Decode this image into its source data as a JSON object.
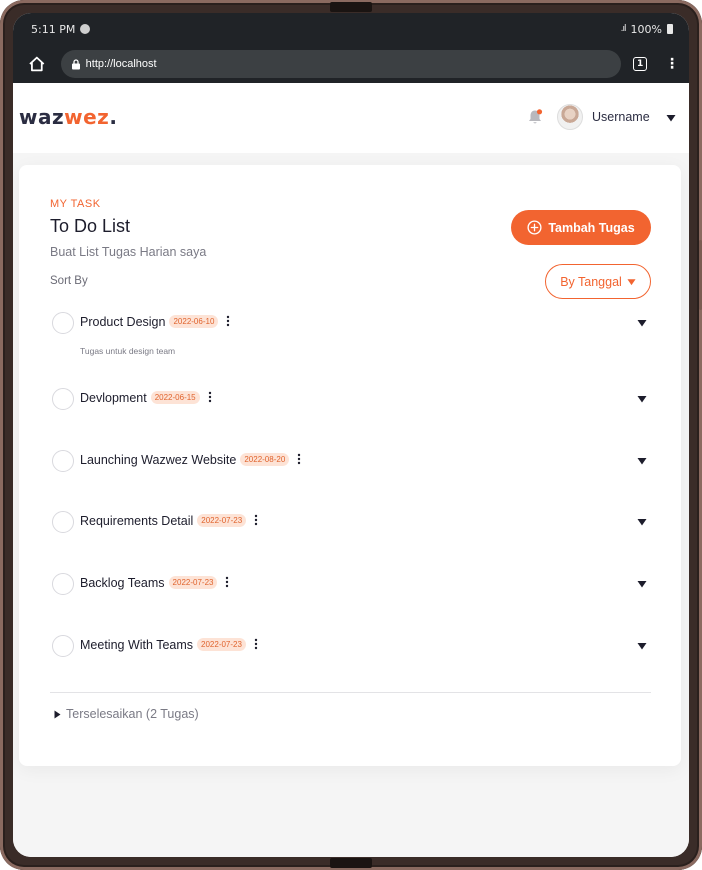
{
  "status_bar": {
    "time": "5:11 PM",
    "battery": "100%"
  },
  "browser": {
    "url": "http://localhost",
    "tab_count": "1"
  },
  "app": {
    "logo_part1": "waz",
    "logo_part2": "wez",
    "logo_dot": ".",
    "username": "Username",
    "accent_color": "#f26430"
  },
  "main": {
    "eyebrow": "MY TASK",
    "title": "To Do List",
    "subtitle": "Buat List Tugas Harian saya",
    "sort_label": "Sort By",
    "add_button": "Tambah Tugas",
    "sort_button": "By Tanggal",
    "tasks": [
      {
        "name": "Product Design",
        "date": "2022-06-10",
        "description": "Tugas untuk design team"
      },
      {
        "name": "Devlopment",
        "date": "2022-06-15"
      },
      {
        "name": "Launching Wazwez Website",
        "date": "2022-08-20"
      },
      {
        "name": "Requirements Detail",
        "date": "2022-07-23"
      },
      {
        "name": "Backlog Teams",
        "date": "2022-07-23"
      },
      {
        "name": "Meeting With Teams",
        "date": "2022-07-23"
      }
    ],
    "completed_label": "Terselesaikan (2 Tugas)"
  }
}
